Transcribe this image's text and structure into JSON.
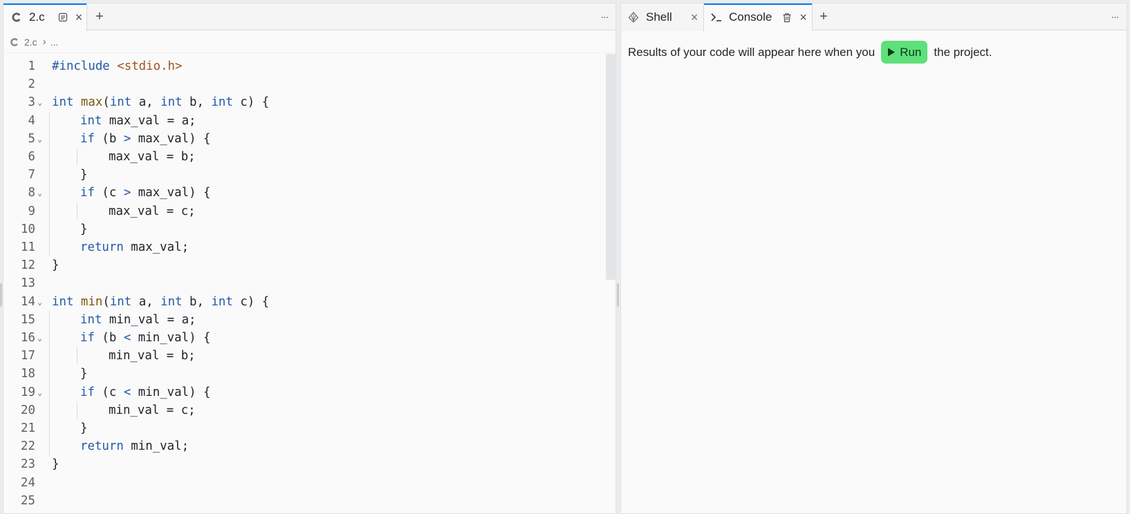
{
  "editor": {
    "tab": {
      "label": "2.c",
      "icon": "c-language-icon"
    },
    "breadcrumb": {
      "file": "2.c",
      "separator": "›",
      "more": "..."
    },
    "lines": [
      {
        "n": "1",
        "fold": false,
        "indent": 0,
        "html": "<span class=\"pp\">#include</span> <span class=\"str\">&lt;stdio.h&gt;</span>"
      },
      {
        "n": "2",
        "fold": false,
        "indent": 0,
        "html": ""
      },
      {
        "n": "3",
        "fold": true,
        "indent": 0,
        "html": "<span class=\"kw\">int</span> <span class=\"fn\">max</span>(<span class=\"kw\">int</span> a, <span class=\"kw\">int</span> b, <span class=\"kw\">int</span> c) {"
      },
      {
        "n": "4",
        "fold": false,
        "indent": 1,
        "html": "<span class=\"kw\">int</span> max_val = a;"
      },
      {
        "n": "5",
        "fold": true,
        "indent": 1,
        "html": "<span class=\"kw\">if</span> (b <span class=\"kw\">&gt;</span> max_val) {"
      },
      {
        "n": "6",
        "fold": false,
        "indent": 2,
        "html": "max_val = b;"
      },
      {
        "n": "7",
        "fold": false,
        "indent": 1,
        "html": "}"
      },
      {
        "n": "8",
        "fold": true,
        "indent": 1,
        "html": "<span class=\"kw\">if</span> (c <span class=\"kw\">&gt;</span> max_val) {"
      },
      {
        "n": "9",
        "fold": false,
        "indent": 2,
        "html": "max_val = c;"
      },
      {
        "n": "10",
        "fold": false,
        "indent": 1,
        "html": "}"
      },
      {
        "n": "11",
        "fold": false,
        "indent": 1,
        "html": "<span class=\"kw\">return</span> max_val;"
      },
      {
        "n": "12",
        "fold": false,
        "indent": 0,
        "html": "}"
      },
      {
        "n": "13",
        "fold": false,
        "indent": 0,
        "html": ""
      },
      {
        "n": "14",
        "fold": true,
        "indent": 0,
        "html": "<span class=\"kw\">int</span> <span class=\"fn\">min</span>(<span class=\"kw\">int</span> a, <span class=\"kw\">int</span> b, <span class=\"kw\">int</span> c) {"
      },
      {
        "n": "15",
        "fold": false,
        "indent": 1,
        "html": "<span class=\"kw\">int</span> min_val = a;"
      },
      {
        "n": "16",
        "fold": true,
        "indent": 1,
        "html": "<span class=\"kw\">if</span> (b <span class=\"kw\">&lt;</span> min_val) {"
      },
      {
        "n": "17",
        "fold": false,
        "indent": 2,
        "html": "min_val = b;"
      },
      {
        "n": "18",
        "fold": false,
        "indent": 1,
        "html": "}"
      },
      {
        "n": "19",
        "fold": true,
        "indent": 1,
        "html": "<span class=\"kw\">if</span> (c <span class=\"kw\">&lt;</span> min_val) {"
      },
      {
        "n": "20",
        "fold": false,
        "indent": 2,
        "html": "min_val = c;"
      },
      {
        "n": "21",
        "fold": false,
        "indent": 1,
        "html": "}"
      },
      {
        "n": "22",
        "fold": false,
        "indent": 1,
        "html": "<span class=\"kw\">return</span> min_val;"
      },
      {
        "n": "23",
        "fold": false,
        "indent": 0,
        "html": "}"
      },
      {
        "n": "24",
        "fold": false,
        "indent": 0,
        "html": ""
      },
      {
        "n": "25",
        "fold": false,
        "indent": 0,
        "html": ""
      }
    ]
  },
  "tools": {
    "shell_tab": {
      "label": "Shell",
      "icon": "shell-icon"
    },
    "console_tab": {
      "label": "Console",
      "icon": "terminal-prompt-icon"
    },
    "console": {
      "message_before": "Results of your code will appear here when you",
      "run_label": "Run",
      "message_after": "the project."
    }
  },
  "icons": {
    "close": "×",
    "add": "+",
    "more": "···",
    "fold": "⌄"
  },
  "colors": {
    "accent": "#0079f2",
    "run_button": "#5ee07a",
    "keyword": "#2359a8",
    "function": "#7a5a12",
    "string": "#a0521d"
  }
}
